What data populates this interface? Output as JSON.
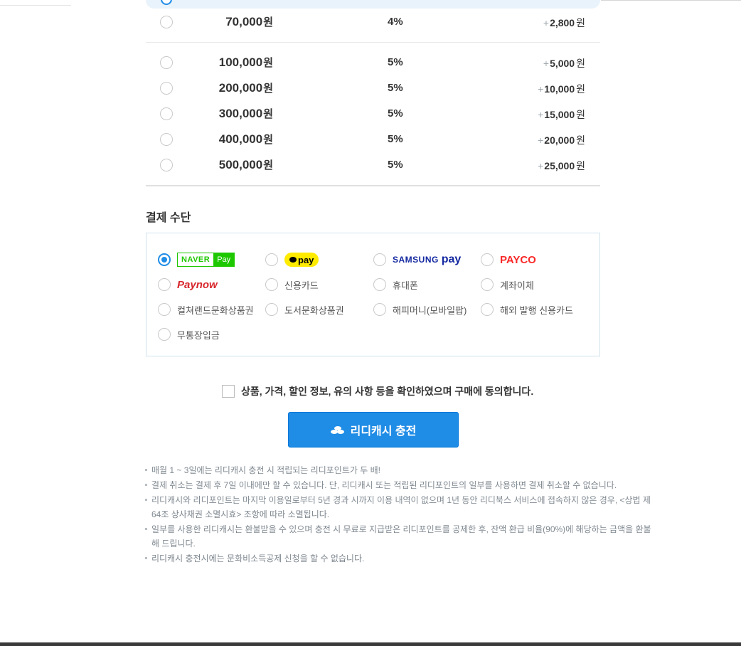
{
  "cash_options": [
    {
      "amount": "70,000",
      "unit": "원",
      "rate": "4%",
      "bonus_plus": "+",
      "bonus": "2,800",
      "bonus_unit": "원"
    },
    {
      "amount": "100,000",
      "unit": "원",
      "rate": "5%",
      "bonus_plus": "+",
      "bonus": "5,000",
      "bonus_unit": "원"
    },
    {
      "amount": "200,000",
      "unit": "원",
      "rate": "5%",
      "bonus_plus": "+",
      "bonus": "10,000",
      "bonus_unit": "원"
    },
    {
      "amount": "300,000",
      "unit": "원",
      "rate": "5%",
      "bonus_plus": "+",
      "bonus": "15,000",
      "bonus_unit": "원"
    },
    {
      "amount": "400,000",
      "unit": "원",
      "rate": "5%",
      "bonus_plus": "+",
      "bonus": "20,000",
      "bonus_unit": "원"
    },
    {
      "amount": "500,000",
      "unit": "원",
      "rate": "5%",
      "bonus_plus": "+",
      "bonus": "25,000",
      "bonus_unit": "원"
    }
  ],
  "payment": {
    "title": "결제 수단",
    "selected": "naverpay",
    "naverpay": {
      "brand": "NAVER",
      "suffix": "Pay"
    },
    "kakaopay": {
      "label": "pay"
    },
    "samsungpay": {
      "brand": "SAMSUNG",
      "suffix": "pay"
    },
    "payco": {
      "label": "PAYCO"
    },
    "paynow": {
      "label": "Paynow"
    },
    "methods": {
      "credit_card": "신용카드",
      "mobile": "휴대폰",
      "bank_transfer": "계좌이체",
      "cultureland": "컬쳐랜드문화상품권",
      "book_gift": "도서문화상품권",
      "happymoney": "해피머니(모바일팝)",
      "overseas_card": "해외 발행 신용카드",
      "deposit": "무통장입금"
    }
  },
  "agreement": {
    "label": "상품, 가격, 할인 정보, 유의 사항 등을 확인하였으며 구매에 동의합니다."
  },
  "charge_button": {
    "label": "리디캐시 충전"
  },
  "notes": [
    "매월 1 ~ 3일에는 리디캐시 충전 시 적립되는 리디포인트가 두 배!",
    "결제 취소는 결제 후 7일 이내에만 할 수 있습니다. 단, 리디캐시 또는 적립된 리디포인트의 일부를 사용하면 결제 취소할 수 없습니다.",
    "리디캐시와 리디포인트는 마지막 이용일로부터 5년 경과 시까지 이용 내역이 없으며 1년 동안 리디북스 서비스에 접속하지 않은 경우, <상법 제 64조 상사채권 소멸시효> 조항에 따라 소멸됩니다.",
    "일부를 사용한 리디캐시는 환불받을 수 있으며 충전 시 무료로 지급받은 리디포인트를 공제한 후, 잔액 환급 비율(90%)에 해당하는 금액을 환불해 드립니다.",
    "리디캐시 충전시에는 문화비소득공제 신청을 할 수 없습니다."
  ]
}
